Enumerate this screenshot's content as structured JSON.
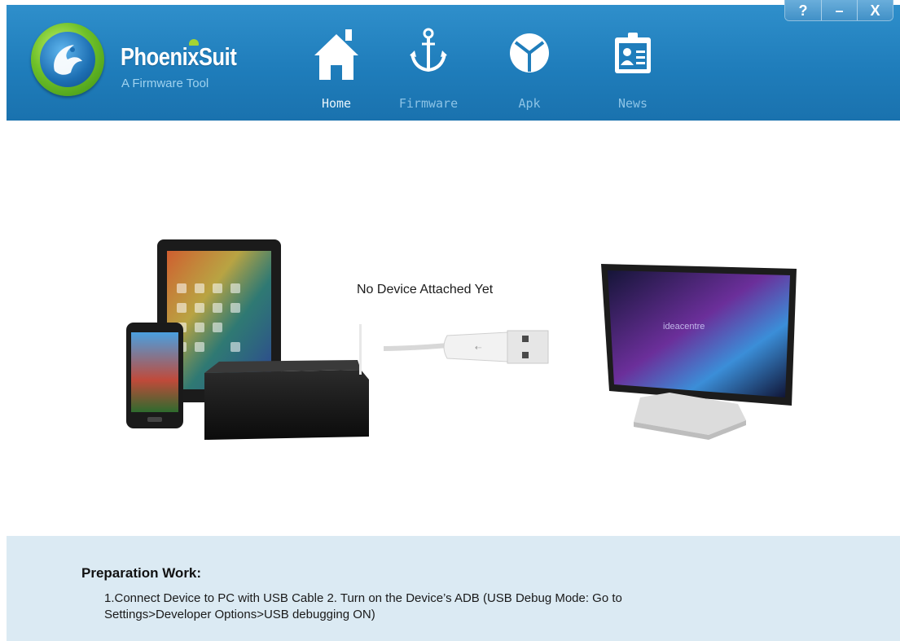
{
  "app": {
    "title": "PhoenixSuit",
    "subtitle": "A Firmware Tool"
  },
  "window_controls": {
    "help": "?",
    "minimize": "–",
    "close": "X"
  },
  "nav": {
    "items": [
      {
        "label": "Home",
        "icon": "home-icon",
        "active": true
      },
      {
        "label": "Firmware",
        "icon": "anchor-icon",
        "active": false
      },
      {
        "label": "Apk",
        "icon": "apk-icon",
        "active": false
      },
      {
        "label": "News",
        "icon": "news-icon",
        "active": false
      }
    ]
  },
  "main": {
    "status": "No Device Attached Yet"
  },
  "footer": {
    "title": "Preparation Work:",
    "line1": "1.Connect Device to PC with USB Cable  2. Turn on the Device’s ADB (USB Debug Mode: Go to",
    "line2": "Settings>Developer Options>USB debugging ON)"
  },
  "colors": {
    "header": "#1f7dbb",
    "footer": "#dbeaf3",
    "logo_ring": "#6fc12a"
  }
}
